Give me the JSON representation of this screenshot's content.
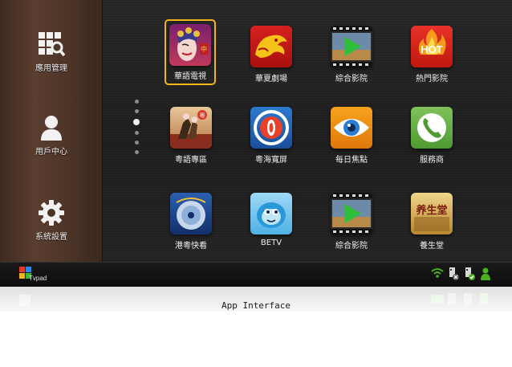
{
  "sidebar": {
    "items": [
      {
        "label": "應用管理",
        "icon": "app-grid-search-icon"
      },
      {
        "label": "用戶中心",
        "icon": "user-icon"
      },
      {
        "label": "系統設置",
        "icon": "gear-icon"
      }
    ]
  },
  "page_indicator": {
    "count": 7,
    "active": 3
  },
  "apps": {
    "row1": [
      {
        "label": "華語電視",
        "icon": "opera-face-icon",
        "selected": true
      },
      {
        "label": "華夏劇場",
        "icon": "dragon-icon"
      },
      {
        "label": "綜合影院",
        "icon": "film-play-icon"
      },
      {
        "label": "熱門影院",
        "icon": "hot-fire-icon",
        "badge": "HOT"
      }
    ],
    "row2": [
      {
        "label": "粵語專區",
        "icon": "cantonese-opera-icon"
      },
      {
        "label": "粵海寬屏",
        "icon": "target-icon"
      },
      {
        "label": "每日焦點",
        "icon": "eye-icon"
      },
      {
        "label": "服務商",
        "icon": "phone-icon"
      }
    ],
    "row3": [
      {
        "label": "港粵快看",
        "icon": "disc-icon"
      },
      {
        "label": "BETV",
        "icon": "betv-mascot-icon"
      },
      {
        "label": "綜合影院",
        "icon": "film-play-icon"
      },
      {
        "label": "養生堂",
        "icon": "yang-sheng-tang-icon",
        "badge": "养生堂"
      }
    ]
  },
  "bottombar": {
    "logo_text": "Tvpad",
    "status_icons": [
      "wifi-icon",
      "usb-disconnected-icon",
      "usb-connected-icon",
      "user-online-icon"
    ]
  },
  "caption": "App Interface",
  "colors": {
    "selection": "#f2b519",
    "wifi": "#4caf1e"
  }
}
